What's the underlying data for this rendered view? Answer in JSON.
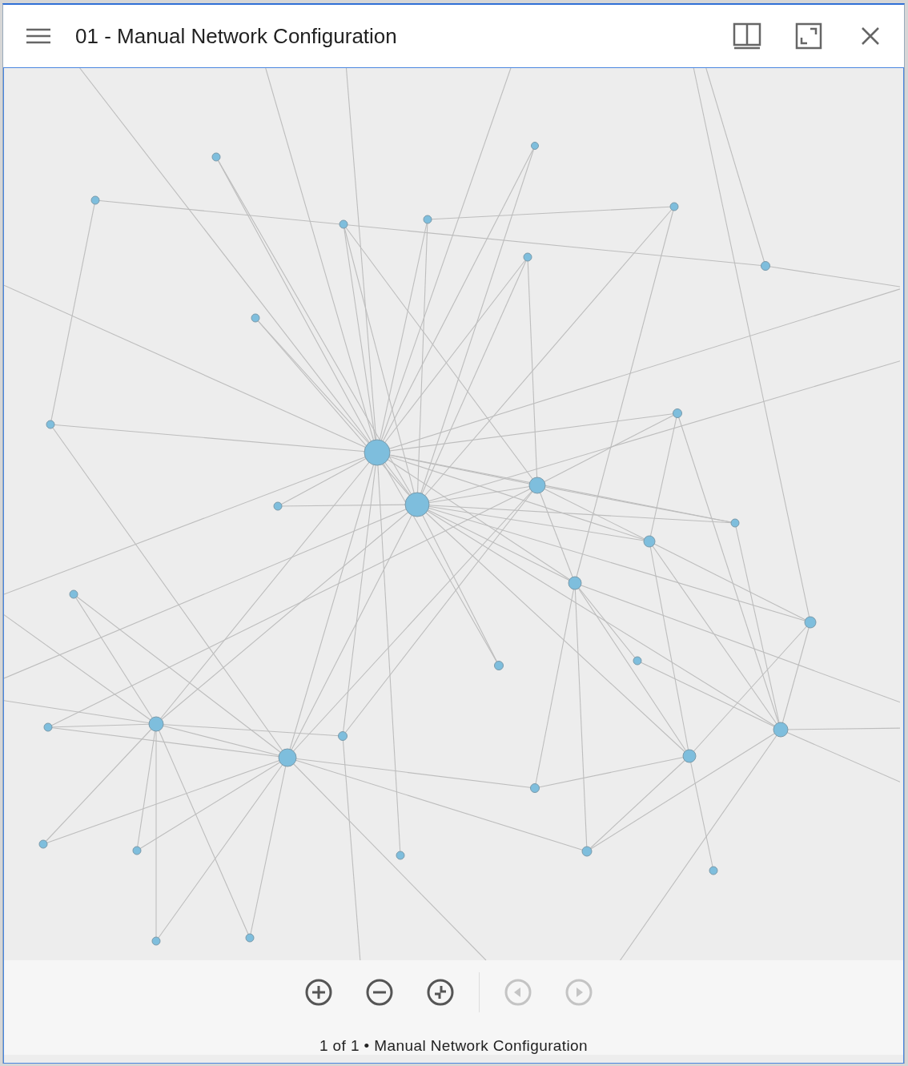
{
  "window": {
    "title": "01 - Manual Network Configuration"
  },
  "toolbar": {
    "buttons": [
      {
        "kind": "zoom_in",
        "disabled": false
      },
      {
        "kind": "zoom_out",
        "disabled": false
      },
      {
        "kind": "reset",
        "disabled": false
      },
      {
        "kind": "previous",
        "disabled": true
      },
      {
        "kind": "next",
        "disabled": true
      }
    ],
    "caption": "1 of 1 • Manual Network Configuration"
  }
}
